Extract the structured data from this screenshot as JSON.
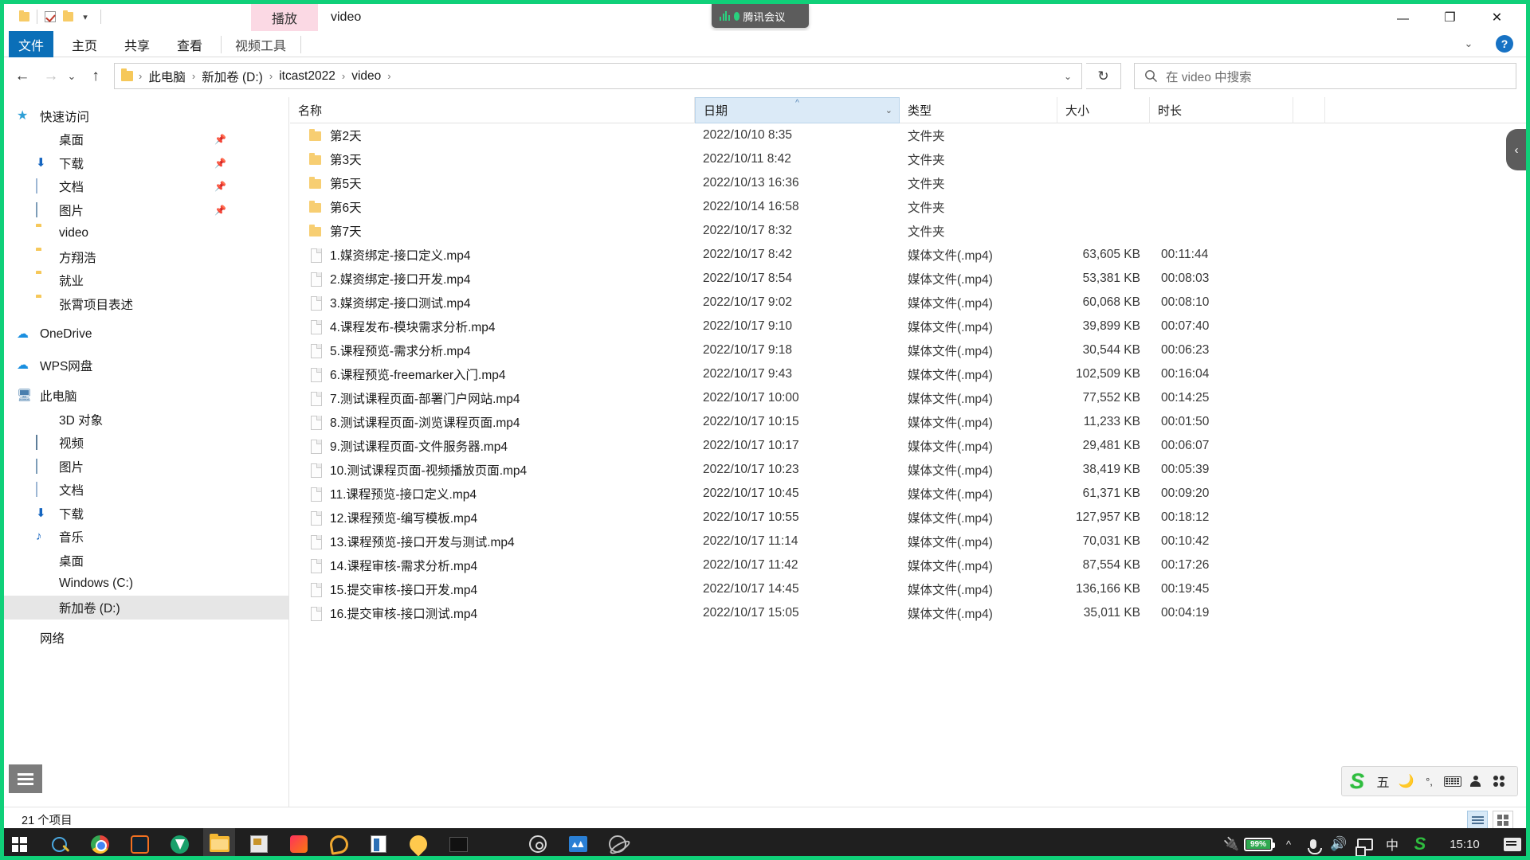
{
  "window": {
    "title": "video",
    "context_tab_label": "播放",
    "quick_access_icons": [
      "folder-icon",
      "checkbox-icon",
      "folder-icon",
      "dropdown-icon"
    ],
    "controls": {
      "minimize": "—",
      "maximize": "❐",
      "close": "✕"
    }
  },
  "tencent_overlay": {
    "label": "腾讯会议"
  },
  "ribbon": {
    "tabs": [
      {
        "id": "file",
        "label": "文件"
      },
      {
        "id": "home",
        "label": "主页"
      },
      {
        "id": "share",
        "label": "共享"
      },
      {
        "id": "view",
        "label": "查看"
      }
    ],
    "contextual_tab": "视频工具",
    "collapse_label": "⌄",
    "help_label": "?"
  },
  "navigation": {
    "back": "←",
    "forward": "→",
    "recent": "⌄",
    "up": "↑",
    "refresh": "↻",
    "breadcrumbs": [
      "此电脑",
      "新加卷 (D:)",
      "itcast2022",
      "video"
    ],
    "dropdown": "⌄"
  },
  "search": {
    "placeholder": "在 video 中搜索",
    "icon": "search-icon"
  },
  "sidebar": {
    "groups": [
      {
        "header": {
          "label": "快速访问",
          "icon": "star-icon"
        },
        "items": [
          {
            "label": "桌面",
            "icon": "desktop-icon",
            "pinned": true
          },
          {
            "label": "下载",
            "icon": "download-icon",
            "pinned": true
          },
          {
            "label": "文档",
            "icon": "documents-icon",
            "pinned": true
          },
          {
            "label": "图片",
            "icon": "pictures-icon",
            "pinned": true
          },
          {
            "label": "video",
            "icon": "folder-icon",
            "pinned": false
          },
          {
            "label": "方翔浩",
            "icon": "folder-icon",
            "pinned": false
          },
          {
            "label": "就业",
            "icon": "folder-icon",
            "pinned": false
          },
          {
            "label": "张霄项目表述",
            "icon": "folder-icon",
            "pinned": false
          }
        ]
      },
      {
        "header": {
          "label": "OneDrive",
          "icon": "onedrive-icon"
        },
        "items": []
      },
      {
        "header": {
          "label": "WPS网盘",
          "icon": "wps-cloud-icon"
        },
        "items": []
      },
      {
        "header": {
          "label": "此电脑",
          "icon": "this-pc-icon"
        },
        "items": [
          {
            "label": "3D 对象",
            "icon": "3d-objects-icon"
          },
          {
            "label": "视频",
            "icon": "videos-icon"
          },
          {
            "label": "图片",
            "icon": "pictures-icon"
          },
          {
            "label": "文档",
            "icon": "documents-icon"
          },
          {
            "label": "下载",
            "icon": "download-icon"
          },
          {
            "label": "音乐",
            "icon": "music-icon"
          },
          {
            "label": "桌面",
            "icon": "desktop-icon"
          },
          {
            "label": "Windows (C:)",
            "icon": "windows-drive-icon"
          },
          {
            "label": "新加卷 (D:)",
            "icon": "drive-icon",
            "selected": true
          }
        ]
      },
      {
        "header": {
          "label": "网络",
          "icon": "network-icon"
        },
        "items": []
      }
    ]
  },
  "columns": [
    {
      "id": "name",
      "label": "名称",
      "sorted": false
    },
    {
      "id": "date",
      "label": "日期",
      "sorted": true,
      "direction": "asc",
      "arrow": "^"
    },
    {
      "id": "type",
      "label": "类型",
      "sorted": false
    },
    {
      "id": "size",
      "label": "大小",
      "sorted": false
    },
    {
      "id": "duration",
      "label": "时长",
      "sorted": false
    }
  ],
  "files": [
    {
      "name": "第2天",
      "kind": "folder",
      "date": "2022/10/10 8:35",
      "type": "文件夹",
      "size": "",
      "duration": ""
    },
    {
      "name": "第3天",
      "kind": "folder",
      "date": "2022/10/11 8:42",
      "type": "文件夹",
      "size": "",
      "duration": ""
    },
    {
      "name": "第5天",
      "kind": "folder",
      "date": "2022/10/13 16:36",
      "type": "文件夹",
      "size": "",
      "duration": ""
    },
    {
      "name": "第6天",
      "kind": "folder",
      "date": "2022/10/14 16:58",
      "type": "文件夹",
      "size": "",
      "duration": ""
    },
    {
      "name": "第7天",
      "kind": "folder",
      "date": "2022/10/17 8:32",
      "type": "文件夹",
      "size": "",
      "duration": ""
    },
    {
      "name": "1.媒资绑定-接口定义.mp4",
      "kind": "file",
      "date": "2022/10/17 8:42",
      "type": "媒体文件(.mp4)",
      "size": "63,605 KB",
      "duration": "00:11:44"
    },
    {
      "name": "2.媒资绑定-接口开发.mp4",
      "kind": "file",
      "date": "2022/10/17 8:54",
      "type": "媒体文件(.mp4)",
      "size": "53,381 KB",
      "duration": "00:08:03"
    },
    {
      "name": "3.媒资绑定-接口测试.mp4",
      "kind": "file",
      "date": "2022/10/17 9:02",
      "type": "媒体文件(.mp4)",
      "size": "60,068 KB",
      "duration": "00:08:10"
    },
    {
      "name": "4.课程发布-模块需求分析.mp4",
      "kind": "file",
      "date": "2022/10/17 9:10",
      "type": "媒体文件(.mp4)",
      "size": "39,899 KB",
      "duration": "00:07:40"
    },
    {
      "name": "5.课程预览-需求分析.mp4",
      "kind": "file",
      "date": "2022/10/17 9:18",
      "type": "媒体文件(.mp4)",
      "size": "30,544 KB",
      "duration": "00:06:23"
    },
    {
      "name": "6.课程预览-freemarker入门.mp4",
      "kind": "file",
      "date": "2022/10/17 9:43",
      "type": "媒体文件(.mp4)",
      "size": "102,509 KB",
      "duration": "00:16:04"
    },
    {
      "name": "7.测试课程页面-部署门户网站.mp4",
      "kind": "file",
      "date": "2022/10/17 10:00",
      "type": "媒体文件(.mp4)",
      "size": "77,552 KB",
      "duration": "00:14:25"
    },
    {
      "name": "8.测试课程页面-浏览课程页面.mp4",
      "kind": "file",
      "date": "2022/10/17 10:15",
      "type": "媒体文件(.mp4)",
      "size": "11,233 KB",
      "duration": "00:01:50"
    },
    {
      "name": "9.测试课程页面-文件服务器.mp4",
      "kind": "file",
      "date": "2022/10/17 10:17",
      "type": "媒体文件(.mp4)",
      "size": "29,481 KB",
      "duration": "00:06:07"
    },
    {
      "name": "10.测试课程页面-视频播放页面.mp4",
      "kind": "file",
      "date": "2022/10/17 10:23",
      "type": "媒体文件(.mp4)",
      "size": "38,419 KB",
      "duration": "00:05:39"
    },
    {
      "name": "11.课程预览-接口定义.mp4",
      "kind": "file",
      "date": "2022/10/17 10:45",
      "type": "媒体文件(.mp4)",
      "size": "61,371 KB",
      "duration": "00:09:20"
    },
    {
      "name": "12.课程预览-编写模板.mp4",
      "kind": "file",
      "date": "2022/10/17 10:55",
      "type": "媒体文件(.mp4)",
      "size": "127,957 KB",
      "duration": "00:18:12"
    },
    {
      "name": "13.课程预览-接口开发与测试.mp4",
      "kind": "file",
      "date": "2022/10/17 11:14",
      "type": "媒体文件(.mp4)",
      "size": "70,031 KB",
      "duration": "00:10:42"
    },
    {
      "name": "14.课程审核-需求分析.mp4",
      "kind": "file",
      "date": "2022/10/17 11:42",
      "type": "媒体文件(.mp4)",
      "size": "87,554 KB",
      "duration": "00:17:26"
    },
    {
      "name": "15.提交审核-接口开发.mp4",
      "kind": "file",
      "date": "2022/10/17 14:45",
      "type": "媒体文件(.mp4)",
      "size": "136,166 KB",
      "duration": "00:19:45"
    },
    {
      "name": "16.提交审核-接口测试.mp4",
      "kind": "file",
      "date": "2022/10/17 15:05",
      "type": "媒体文件(.mp4)",
      "size": "35,011 KB",
      "duration": "00:04:19"
    }
  ],
  "pane_collapse": {
    "icon": "chevron-left-icon"
  },
  "statusbar": {
    "item_count": "21 个项目",
    "view_details_icon": "details-view-icon",
    "view_icons_icon": "large-icons-view-icon"
  },
  "sogou_ime": {
    "logo": "S",
    "mode": "五",
    "items": [
      "moon-icon",
      "punctuation-icon",
      "keyboard-icon",
      "person-icon",
      "apps-icon"
    ]
  },
  "taskbar": {
    "start": "windows-logo-icon",
    "search": "cortana-search-icon",
    "apps": [
      {
        "name": "chrome",
        "glyph": "g-chrome",
        "running": true,
        "active": false
      },
      {
        "name": "photoshop",
        "glyph": "g-ps",
        "running": true,
        "active": false
      },
      {
        "name": "video-player",
        "glyph": "g-v",
        "running": true,
        "active": false
      },
      {
        "name": "file-explorer",
        "glyph": "g-explorer",
        "running": true,
        "active": true
      },
      {
        "name": "news-reader",
        "glyph": "g-news",
        "running": true,
        "active": false
      },
      {
        "name": "intellij-idea",
        "glyph": "g-idea",
        "running": true,
        "active": false
      },
      {
        "name": "lens-app",
        "glyph": "g-lens",
        "running": true,
        "active": false
      },
      {
        "name": "reader-app",
        "glyph": "g-book",
        "running": true,
        "active": false
      },
      {
        "name": "water-drop",
        "glyph": "g-drop",
        "running": true,
        "active": false
      },
      {
        "name": "terminal",
        "glyph": "g-term",
        "running": true,
        "active": false
      },
      {
        "name": "settings",
        "glyph": "g-gear",
        "running": true,
        "active": false
      },
      {
        "name": "disc-app",
        "glyph": "g-disc",
        "running": true,
        "active": false
      },
      {
        "name": "wave-editor",
        "glyph": "g-wave",
        "running": true,
        "active": false
      },
      {
        "name": "orbit-app",
        "glyph": "g-orbit",
        "running": false,
        "active": false
      }
    ],
    "tray": {
      "plug": "power-plug-icon",
      "battery_percent": "99%",
      "show_hidden": "^",
      "mic": "microphone-icon",
      "volume": "volume-icon",
      "display": "display-icon",
      "ime_mode": "中",
      "sogou": "S",
      "clock": "15:10",
      "notifications": "action-center-icon"
    }
  },
  "colors": {
    "share_border": "#10d079",
    "file_tab": "#0b6fb8",
    "contextual_tab": "#fbd9e4",
    "sort_highlight": "#dbeaf7",
    "selection": "#e6e6e6",
    "taskbar": "#1f1f1f",
    "battery_green": "#2fa84f",
    "sogou_green": "#2fbd3f"
  }
}
